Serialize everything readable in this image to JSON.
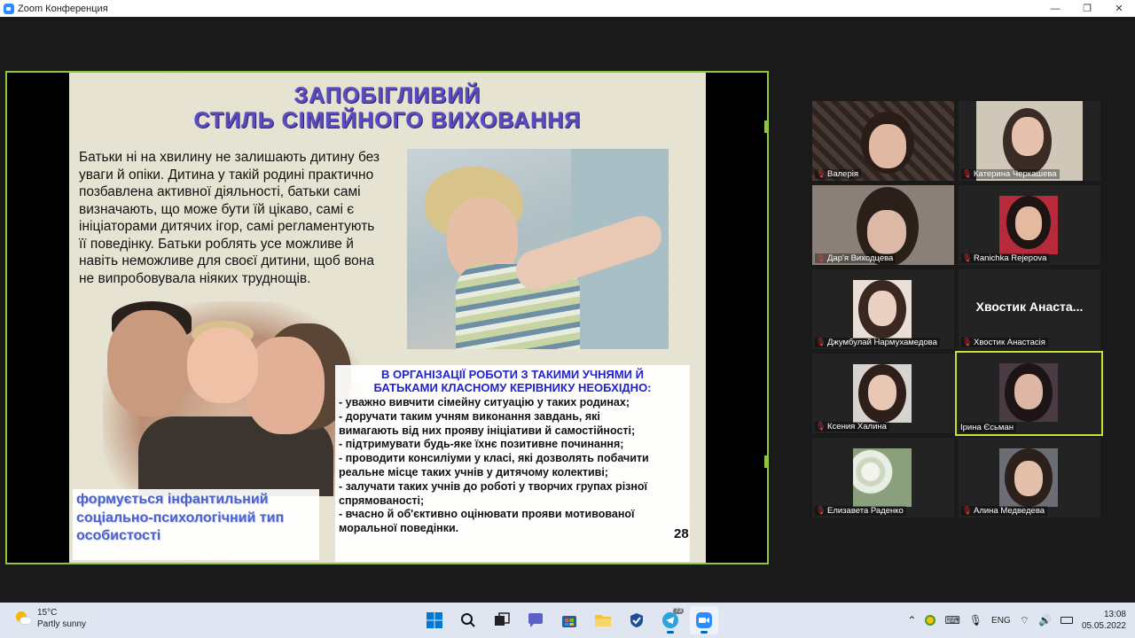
{
  "window": {
    "title": "Zoom Конференция",
    "minimize": "—",
    "restore": "❐",
    "close": "✕"
  },
  "slide": {
    "title_line1": "ЗАПОБІГЛИВИЙ",
    "title_line2": "СТИЛЬ СІМЕЙНОГО ВИХОВАННЯ",
    "paragraph": "Батьки ні на хвилину не залишають дитину без уваги й опіки. Дитина у такій родині практично позбавлена активної діяльності, батьки самі визначають, що може бути їй цікаво, самі є ініціаторами дитячих ігор, самі регламентують її поведінку. Батьки роблять усе можливе й навіть неможливе для своєї дитини, щоб вона не випробовувала ніяких труднощів.",
    "caption": "формується інфантильний соціально-психологічний тип особистості",
    "list_heading_line1": "В ОРГАНІЗАЦІЇ РОБОТИ З ТАКИМИ УЧНЯМИ Й",
    "list_heading_line2": "БАТЬКАМИ КЛАСНОМУ КЕРІВНИКУ НЕОБХІДНО:",
    "list_lines": [
      "- уважно вивчити сімейну ситуацію у таких родинах;",
      "- доручати таким учням виконання завдань, які",
      "вимагають від них прояву ініціативи й самостійності;",
      "- підтримувати будь-яке їхнє позитивне починання;",
      "- проводити консиліуми у класі, які дозволять побачити",
      "реальне місце таких учнів у дитячому колективі;",
      "- залучати таких учнів до роботі у творчих групах різної",
      "спрямованості;",
      "- вчасно й об'єктивно оцінювати прояви мотивованої",
      "моральної поведінки."
    ],
    "page_number": "28"
  },
  "participants": [
    {
      "name": "Валерія",
      "muted": true,
      "active": false
    },
    {
      "name": "Катерина Черкашева",
      "muted": true,
      "active": false
    },
    {
      "name": "Дар'я Виходцева",
      "muted": true,
      "active": false
    },
    {
      "name": "Ranichka Rejepova",
      "muted": true,
      "active": false
    },
    {
      "name": "Джумбулай Нармухамедова",
      "muted": true,
      "active": false
    },
    {
      "name": "Хвостик Анастасія",
      "muted": true,
      "active": false,
      "display_text": "Хвостик Анаста..."
    },
    {
      "name": "Ксения Халина",
      "muted": true,
      "active": false
    },
    {
      "name": "Ірина Єсьман",
      "muted": false,
      "active": true
    },
    {
      "name": "Елизавета Раденко",
      "muted": true,
      "active": false
    },
    {
      "name": "Алина Медведева",
      "muted": true,
      "active": false
    }
  ],
  "taskbar": {
    "weather_temp": "15°C",
    "weather_desc": "Partly sunny",
    "apps": [
      "windows-start-icon",
      "search-icon",
      "task-view-icon",
      "chat-icon",
      "store-icon",
      "file-explorer-icon",
      "security-icon",
      "telegram-icon",
      "zoom-icon"
    ],
    "telegram_badge": "73",
    "lang": "ENG",
    "time": "13:08",
    "date": "05.05.2022"
  },
  "colors": {
    "share_border": "#8fc63f",
    "active_speaker": "#c8e034",
    "slide_title": "#5a4bc4",
    "list_heading": "#2222cc",
    "caption": "#4b63c9"
  }
}
